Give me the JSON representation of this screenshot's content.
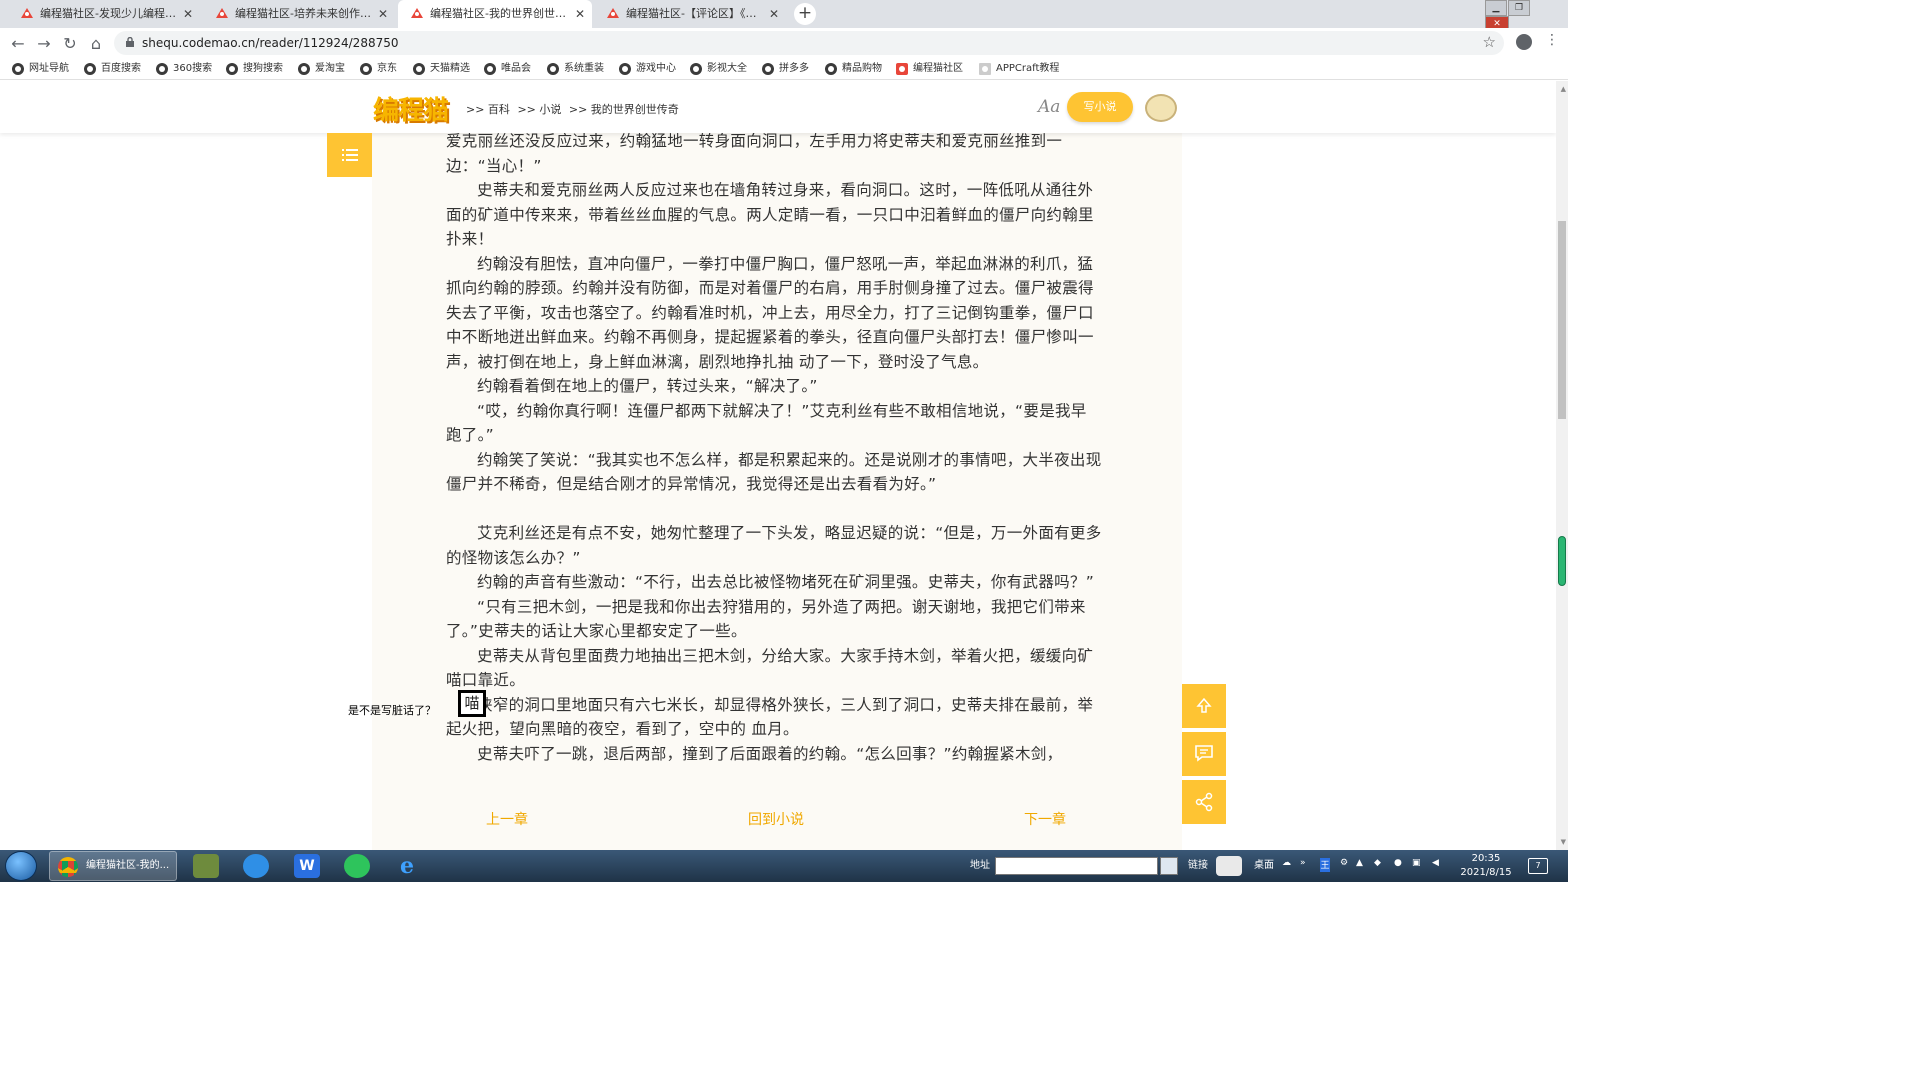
{
  "browser": {
    "tabs": [
      {
        "title": "编程猫社区-发现少儿编程作品",
        "active": false
      },
      {
        "title": "编程猫社区-培养未来创作者 - 首",
        "active": false
      },
      {
        "title": "编程猫社区-我的世界创世传奇-小",
        "active": true
      },
      {
        "title": "编程猫社区-【评论区】《我的世",
        "active": false
      }
    ],
    "new_tab": "+",
    "url": "shequ.codemao.cn/reader/112924/288750",
    "bookmarks": [
      "网址导航",
      "百度搜索",
      "360搜索",
      "搜狗搜索",
      "爱淘宝",
      "京东",
      "天猫精选",
      "唯品会",
      "系统重装",
      "游戏中心",
      "影视大全",
      "拼多多",
      "精品购物",
      "编程猫社区",
      "APPCraft教程"
    ]
  },
  "site": {
    "logo": "编程猫",
    "breadcrumb": [
      ">> 百科",
      ">> 小说",
      ">> 我的世界创世传奇"
    ],
    "font_button": "Aa",
    "write_button": "写小说",
    "accent": "#fec433"
  },
  "reader": {
    "paragraphs": [
      "爱克丽丝还没反应过来，约翰猛地一转身面向洞口，左手用力将史蒂夫和爱克丽丝推到一边：“当心！”",
      "史蒂夫和爱克丽丝两人反应过来也在墙角转过身来，看向洞口。这时，一阵低吼从通往外面的矿道中传来来，带着丝丝血腥的气息。两人定睛一看，一只口中汩着鲜血的僵尸向约翰里扑来！",
      "约翰没有胆怯，直冲向僵尸，一拳打中僵尸胸口，僵尸怒吼一声，举起血淋淋的利爪，猛抓向约翰的脖颈。约翰并没有防御，而是对着僵尸的右肩，用手肘侧身撞了过去。僵尸被震得失去了平衡，攻击也落空了。约翰看准时机，冲上去，用尽全力，打了三记倒钩重拳，僵尸口中不断地迸出鲜血来。约翰不再侧身，提起握紧着的拳头，径直向僵尸头部打去！僵尸惨叫一声，被打倒在地上，身上鲜血淋漓，剧烈地挣扎抽 动了一下，登时没了气息。",
      "约翰看着倒在地上的僵尸，转过头来，“解决了。”",
      "“哎，约翰你真行啊！连僵尸都两下就解决了！”艾克利丝有些不敢相信地说，“要是我早跑了。”",
      "约翰笑了笑说：“我其实也不怎么样，都是积累起来的。还是说刚才的事情吧，大半夜出现僵尸并不稀奇，但是结合刚才的异常情况，我觉得还是出去看看为好。”",
      "",
      "艾克利丝还是有点不安，她匆忙整理了一下头发，略显迟疑的说：“但是，万一外面有更多的怪物该怎么办？”",
      "约翰的声音有些激动：“不行，出去总比被怪物堵死在矿洞里强。史蒂夫，你有武器吗？”",
      "“只有三把木剑，一把是我和你出去狩猎用的，另外造了两把。谢天谢地，我把它们带来了。”史蒂夫的话让大家心里都安定了一些。",
      "史蒂夫从背包里面费力地抽出三把木剑，分给大家。大家手持木剑，举着火把，缓缓向矿喵口靠近。",
      "狭窄的洞口里地面只有六七米长，却显得格外狭长，三人到了洞口，史蒂夫排在最前，举起火把，望向黑暗的夜空，看到了，空中的 血月。",
      "史蒂夫吓了一跳，退后两部，撞到了后面跟着的约翰。“怎么回事？”约翰握紧木剑，"
    ],
    "highlight_char": "喵",
    "annotation": "是不是写脏话了？",
    "prev_chapter": "上一章",
    "back_to_novel": "回到小说",
    "next_chapter": "下一章"
  },
  "taskbar": {
    "chrome_task": "编程猫社区-我的...",
    "address_label": "地址",
    "links_label": "链接",
    "desktop_label": "桌面",
    "time": "20:35",
    "date": "2021/8/15",
    "notif_count": "7"
  }
}
